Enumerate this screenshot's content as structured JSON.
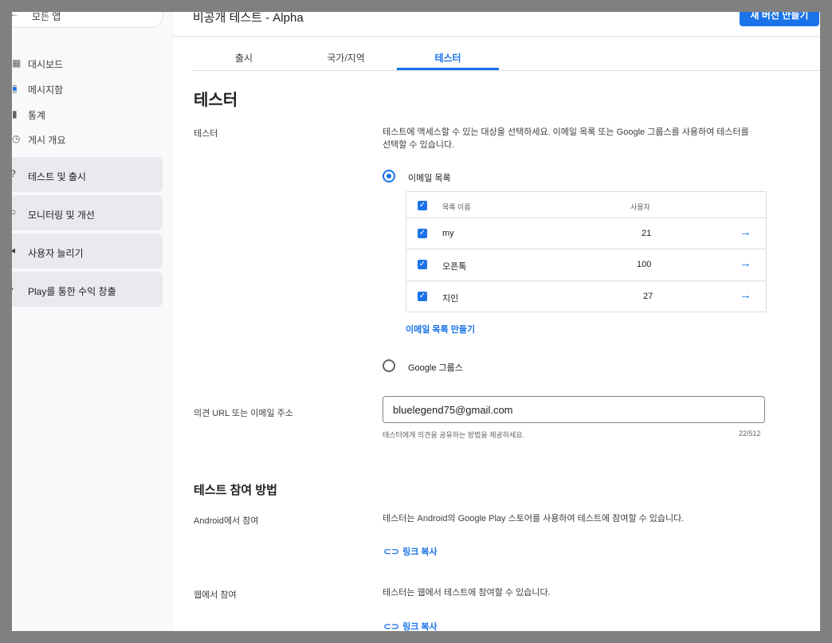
{
  "sidebar": {
    "all_apps": "모든 앱",
    "items": [
      {
        "label": "대시보드"
      },
      {
        "label": "메시지함"
      },
      {
        "label": "통계"
      },
      {
        "label": "게시 개요"
      }
    ],
    "sections": [
      {
        "label": "테스트 및 출시"
      },
      {
        "label": "모니터링 및 개선"
      },
      {
        "label": "사용자 늘리기"
      },
      {
        "label": "Play를 통한 수익 창출"
      }
    ]
  },
  "header": {
    "title": "비공개 테스트 - Alpha",
    "new_release": "새 버전 만들기"
  },
  "tabs": [
    {
      "label": "출시"
    },
    {
      "label": "국가/지역"
    },
    {
      "label": "테스터"
    }
  ],
  "active_tab": "테스터",
  "page_title": "테스터",
  "testers": {
    "label": "테스터",
    "description_line1": "테스트에 액세스할 수 있는 대상을 선택하세요. 이메일 목록 또는 Google 그룹스를 사용하여 테스터를",
    "description_line2": "선택할 수 있습니다.",
    "email_option": "이메일 목록",
    "groups_option": "Google 그룹스",
    "selected_option": "이메일 목록",
    "table": {
      "col_name": "목록 이름",
      "col_users": "사용자",
      "rows": [
        {
          "name": "my",
          "users": "21"
        },
        {
          "name": "오픈톡",
          "users": "100"
        },
        {
          "name": "지인",
          "users": "27"
        }
      ]
    },
    "create_list": "이메일 목록 만들기"
  },
  "feedback": {
    "label": "의견 URL 또는 이메일 주소",
    "value": "bluelegend75@gmail.com",
    "helper": "테스터에게 의견을 공유하는 방법을 제공하세요.",
    "counter": "22/512"
  },
  "join": {
    "title": "테스트 참여 방법",
    "android_label": "Android에서 참여",
    "android_desc": "테스터는 Android의 Google Play 스토어를 사용하여 테스트에 참여할 수 있습니다.",
    "web_label": "웹에서 참여",
    "web_desc": "테스터는 웹에서 테스트에 참여할 수 있습니다.",
    "copy_link": "링크 복사"
  },
  "colors": {
    "accent": "#1a73e8",
    "sidebar_bg": "#f8f9fa",
    "section_bg": "#e8eaed"
  }
}
